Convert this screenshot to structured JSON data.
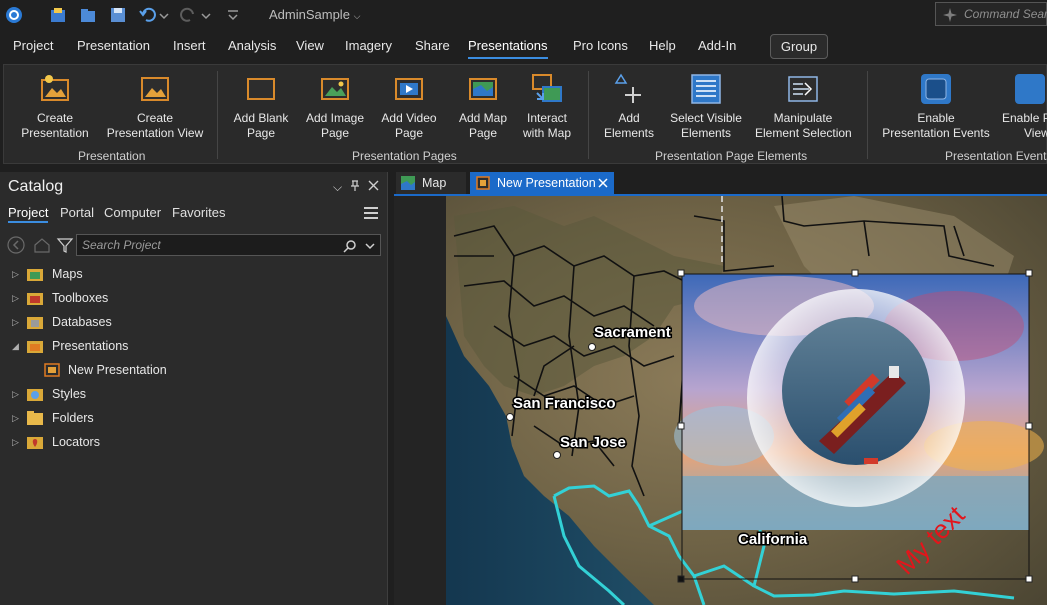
{
  "titlebar": {
    "app_title": "AdminSample",
    "command_search_placeholder": "Command Search"
  },
  "menu": [
    "Project",
    "Presentation",
    "Insert",
    "Analysis",
    "View",
    "Imagery",
    "Share",
    "Presentations",
    "Pro Icons",
    "Help",
    "Add-In"
  ],
  "menu_active": "Presentations",
  "group_button": "Group",
  "ribbon": {
    "presentation": {
      "label": "Presentation",
      "create_presentation": [
        "Create",
        "Presentation"
      ],
      "create_presentation_view": [
        "Create",
        "Presentation View"
      ]
    },
    "pages": {
      "label": "Presentation Pages",
      "add_blank": [
        "Add Blank",
        "Page"
      ],
      "add_image": [
        "Add Image",
        "Page"
      ],
      "add_video": [
        "Add Video",
        "Page"
      ],
      "add_map": [
        "Add Map",
        "Page"
      ],
      "interact": [
        "Interact",
        "with Map"
      ]
    },
    "elements": {
      "label": "Presentation Page Elements",
      "add_elements": [
        "Add",
        "Elements"
      ],
      "select_visible": [
        "Select Visible",
        "Elements"
      ],
      "manipulate": [
        "Manipulate",
        "Element Selection"
      ]
    },
    "events": {
      "label": "Presentation Events",
      "enable_events": [
        "Enable",
        "Presentation Events"
      ],
      "enable_view": [
        "Enable P",
        "View"
      ]
    }
  },
  "catalog": {
    "title": "Catalog",
    "tabs": [
      "Project",
      "Portal",
      "Computer",
      "Favorites"
    ],
    "active_tab": "Project",
    "search_placeholder": "Search Project",
    "tree": [
      {
        "label": "Maps",
        "expanded": false
      },
      {
        "label": "Toolboxes",
        "expanded": false
      },
      {
        "label": "Databases",
        "expanded": false
      },
      {
        "label": "Presentations",
        "expanded": true
      },
      {
        "label": "New Presentation",
        "child": true
      },
      {
        "label": "Styles",
        "expanded": false
      },
      {
        "label": "Folders",
        "expanded": false
      },
      {
        "label": "Locators",
        "expanded": false
      }
    ]
  },
  "view_tabs": {
    "map": "Map",
    "presentation": "New Presentation"
  },
  "map_labels": {
    "sacramento": "Sacrament",
    "san_francisco": "San Francisco",
    "san_jose": "San Jose",
    "california": "California"
  },
  "overlay_text": "My text",
  "colors": {
    "accent": "#1b6ac9",
    "boundary": "#33d1d6",
    "overlay_text": "#e3151b"
  }
}
